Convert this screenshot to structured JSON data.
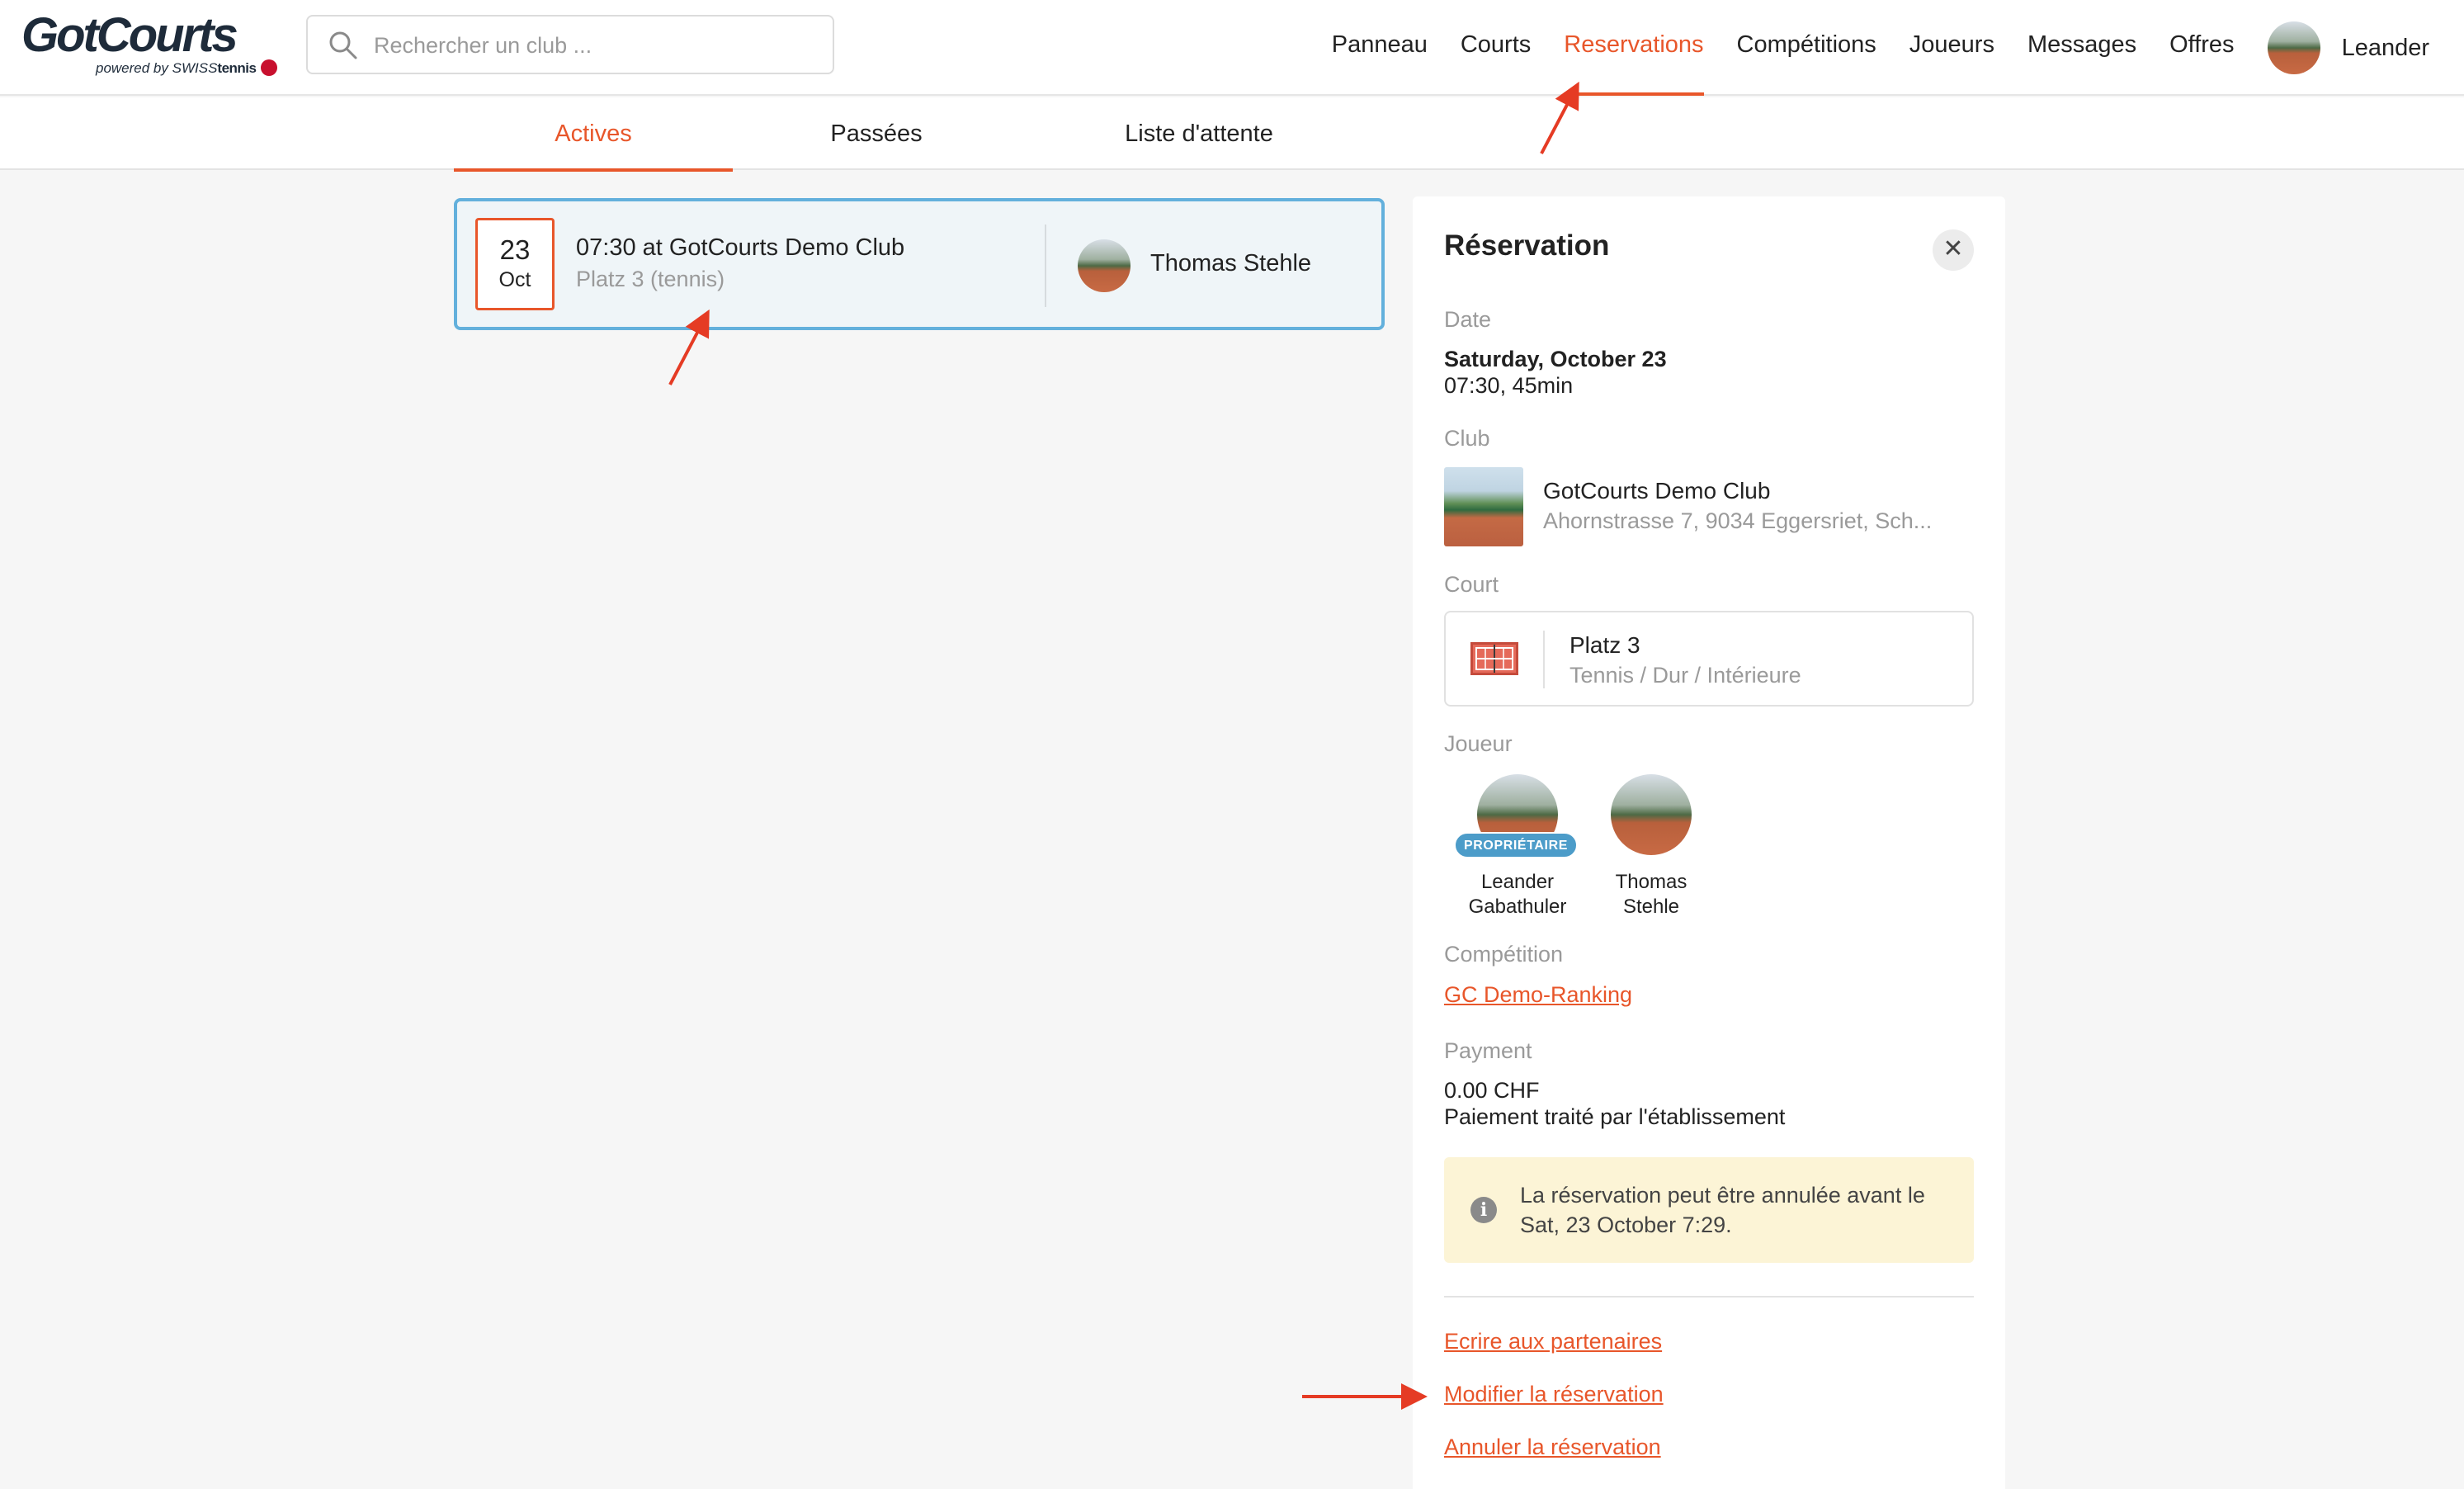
{
  "brand": {
    "name": "GotCourts",
    "powered_by": "powered by",
    "partner_brand_prefix": "SWISS",
    "partner_brand_suffix": "tennis"
  },
  "search": {
    "placeholder": "Rechercher un club ...",
    "value": ""
  },
  "nav": {
    "items": [
      "Panneau",
      "Courts",
      "Reservations",
      "Compétitions",
      "Joueurs",
      "Messages",
      "Offres"
    ],
    "active": "Reservations",
    "user_name": "Leander"
  },
  "tabs": {
    "items": [
      "Actives",
      "Passées",
      "Liste d'attente"
    ],
    "active": "Actives"
  },
  "reservation_card": {
    "day": "23",
    "month": "Oct",
    "title": "07:30 at GotCourts Demo Club",
    "subtitle": "Platz 3 (tennis)",
    "player": "Thomas Stehle"
  },
  "detail": {
    "title": "Réservation",
    "date_label": "Date",
    "date_value": "Saturday, October 23",
    "time_value": "07:30, 45min",
    "club_label": "Club",
    "club_name": "GotCourts Demo Club",
    "club_address": "Ahornstrasse 7, 9034 Eggersriet, Sch...",
    "court_label": "Court",
    "court_name": "Platz 3",
    "court_meta": "Tennis / Dur / Intérieure",
    "players_label": "Joueur",
    "players": [
      {
        "first": "Leander",
        "last": "Gabathuler",
        "badge": "PROPRIÉTAIRE"
      },
      {
        "first": "Thomas",
        "last": "Stehle"
      }
    ],
    "competition_label": "Compétition",
    "competition_link": "GC Demo-Ranking",
    "payment_label": "Payment",
    "payment_amount": "0.00 CHF",
    "payment_note": "Paiement traité par l'établissement",
    "notice": "La réservation peut être annulée avant le Sat, 23 October 7:29.",
    "actions": [
      "Ecrire aux partenaires",
      "Modifier la réservation",
      "Annuler la réservation"
    ]
  },
  "colors": {
    "accent": "#e8562a",
    "selected_border": "#63b0dc",
    "owner_badge": "#4c9cc9",
    "notice_bg": "#fcf4d6",
    "annotation": "#e53b24"
  }
}
